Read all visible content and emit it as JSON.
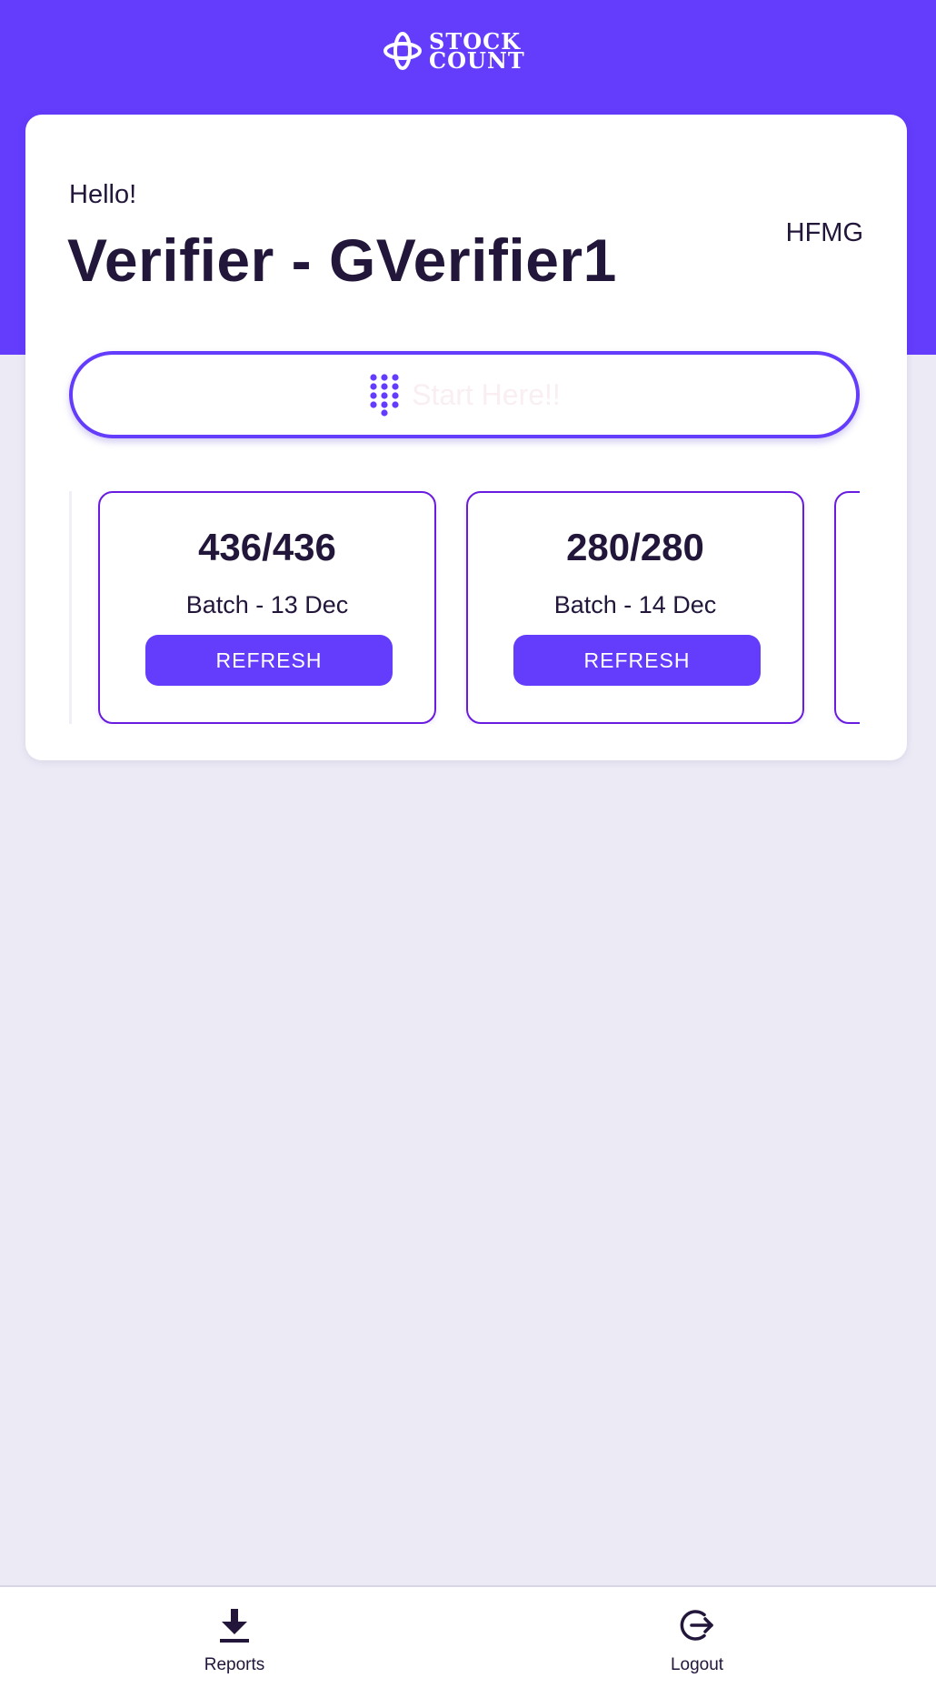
{
  "header": {
    "logo_line1": "STOCK",
    "logo_line2": "COUNT"
  },
  "profile": {
    "greeting": "Hello!",
    "user_title": "Verifier - GVerifier1",
    "org_code": "HFMG"
  },
  "start": {
    "label": "Start Here!!",
    "icon": "keypad-icon"
  },
  "batches": [
    {
      "count": "436/436",
      "name": "Batch - 13 Dec",
      "action": "REFRESH"
    },
    {
      "count": "280/280",
      "name": "Batch - 14 Dec",
      "action": "REFRESH"
    }
  ],
  "bottom_nav": [
    {
      "label": "Reports",
      "icon": "download-icon"
    },
    {
      "label": "Logout",
      "icon": "logout-icon"
    }
  ],
  "colors": {
    "accent": "#643cfc",
    "card_border": "#6a1be0",
    "text": "#22163a",
    "background": "#ecebf5"
  }
}
